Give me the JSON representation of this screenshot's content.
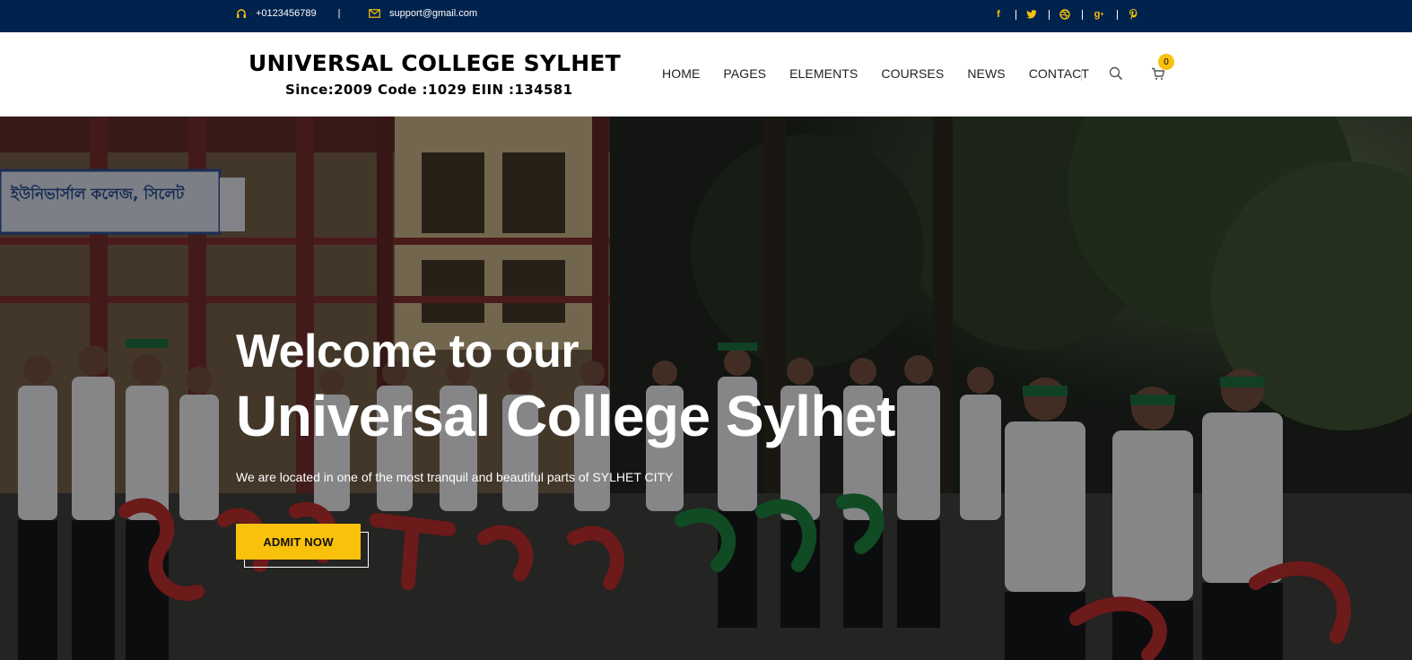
{
  "topbar": {
    "phone": "+0123456789",
    "divider": "|",
    "email": "support@gmail.com",
    "social_icons": [
      "facebook-icon",
      "twitter-icon",
      "dribbble-icon",
      "google-plus-icon",
      "pinterest-icon"
    ],
    "accent_color": "#f9c10b",
    "background_color": "#00234d"
  },
  "header": {
    "brand_name": "UNIVERSAL COLLEGE SYLHET",
    "brand_since": "Since:2009 Code :1029 EIIN :134581",
    "nav": {
      "home": "HOME",
      "pages": "PAGES",
      "elements": "ELEMENTS",
      "courses": "COURSES",
      "news": "NEWS",
      "contact": "CONTACT"
    },
    "cart_count": "0"
  },
  "hero": {
    "title_line1": "Welcome to our",
    "title_line2": "Universal College Sylhet",
    "tagline": "We are located in one of the most tranquil and beautiful parts of SYLHET CITY",
    "cta_label": "ADMIT NOW",
    "cta_color": "#f9c10b",
    "sign_text": "ইউনিভার্সাল কলেজ, সিলেট"
  }
}
